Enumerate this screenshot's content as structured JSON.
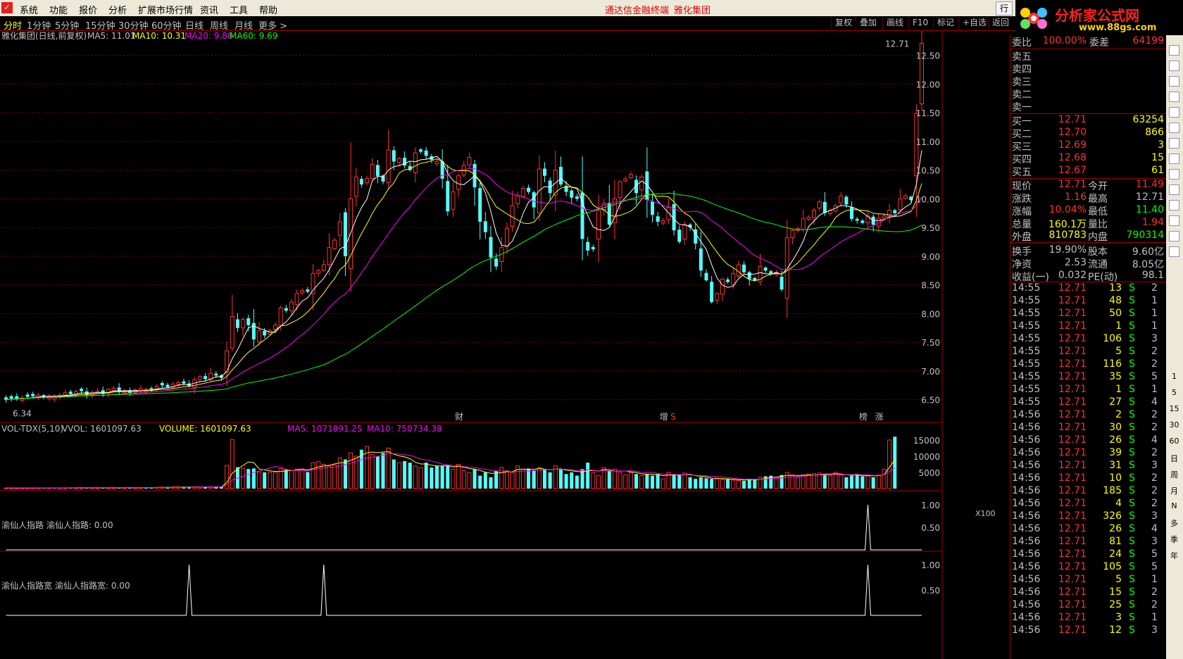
{
  "app": {
    "menu": [
      "系统",
      "功能",
      "报价",
      "分析",
      "扩展市场行情",
      "资讯",
      "工具",
      "帮助"
    ],
    "center_title_1": "通达信金融终端",
    "center_title_2": "雅化集团",
    "window_btn": "行"
  },
  "logo": {
    "title": "分析家公式网",
    "url": "www.88gs.com"
  },
  "periods": [
    "分时",
    "1分钟",
    "5分钟",
    "15分钟",
    "30分钟",
    "60分钟",
    "日线",
    "周线",
    "月线",
    "更多 >"
  ],
  "toolbar_buttons": [
    "复权",
    "叠加",
    "画线",
    "F10",
    "标记",
    "+自选",
    "返回"
  ],
  "main_chart": {
    "header": {
      "name": "雅化集团(日线,前复权)",
      "ma5": "MA5: 11.01",
      "ma10": "MA10: 10.31",
      "ma20": "MA20: 9.86",
      "ma60": "MA60: 9.69"
    },
    "high_label": "12.71",
    "low_label": "6.34",
    "markers": [
      {
        "i": 84,
        "text": "财"
      },
      {
        "i": 122,
        "text": "增"
      },
      {
        "i": 124,
        "text": "S"
      },
      {
        "i": 159,
        "text": "榜"
      },
      {
        "i": 162,
        "text": "涨"
      }
    ],
    "y_ticks": [
      "12.50",
      "12.00",
      "11.50",
      "11.00",
      "10.50",
      "10.00",
      "9.50",
      "9.00",
      "8.50",
      "8.00",
      "7.50",
      "7.00",
      "6.50"
    ]
  },
  "chart_data": [
    {
      "type": "candlestick",
      "y_range": [
        6.3,
        12.85
      ],
      "ma_colors": {
        "ma5": "#ffffff",
        "ma10": "#ffff00",
        "ma20": "#ff00ff",
        "ma60": "#00ff00"
      },
      "up_color": "#ff3232",
      "down_color": "#54ffff",
      "close": [
        6.5,
        6.52,
        6.52,
        6.53,
        6.55,
        6.56,
        6.58,
        6.55,
        6.56,
        6.55,
        6.58,
        6.62,
        6.6,
        6.64,
        6.65,
        6.58,
        6.62,
        6.65,
        6.6,
        6.68,
        6.7,
        6.64,
        6.66,
        6.62,
        6.67,
        6.69,
        6.68,
        6.66,
        6.73,
        6.75,
        6.72,
        6.77,
        6.8,
        6.78,
        6.74,
        6.85,
        6.9,
        6.86,
        6.96,
        6.92,
        6.88,
        7.35,
        7.95,
        7.75,
        7.9,
        7.8,
        7.55,
        7.7,
        7.62,
        7.7,
        7.8,
        8.1,
        8.05,
        8.2,
        8.35,
        8.4,
        8.38,
        8.7,
        8.75,
        8.85,
        9.15,
        9.28,
        9.6,
        9.0,
        10.0,
        10.38,
        10.25,
        10.35,
        10.6,
        10.4,
        10.3,
        10.85,
        10.65,
        10.7,
        10.58,
        10.5,
        10.8,
        10.82,
        10.75,
        10.68,
        10.65,
        10.35,
        9.78,
        10.12,
        10.4,
        10.58,
        10.72,
        10.2,
        9.6,
        9.42,
        8.98,
        8.82,
        9.15,
        9.48,
        9.88,
        10.05,
        10.18,
        10.12,
        9.85,
        10.52,
        10.4,
        10.1,
        10.5,
        10.25,
        10.12,
        10.02,
        10.0,
        9.3,
        9.1,
        9.12,
        9.8,
        9.92,
        9.55,
        10.0,
        10.3,
        10.35,
        10.42,
        10.1,
        10.38,
        9.98,
        9.72,
        9.6,
        9.62,
        9.85,
        9.45,
        9.25,
        9.55,
        9.5,
        9.22,
        8.75,
        8.58,
        8.2,
        8.35,
        8.6,
        8.55,
        8.7,
        8.85,
        8.72,
        8.6,
        8.58,
        8.82,
        8.75,
        8.7,
        8.72,
        8.42,
        9.32,
        9.45,
        9.48,
        9.65,
        9.68,
        9.8,
        9.95,
        9.75,
        9.8,
        9.88,
        10.05,
        9.9,
        9.65,
        9.62,
        9.58,
        9.7,
        9.55,
        9.66,
        9.7,
        9.8,
        9.75,
        10.0,
        10.05,
        9.98,
        11.48,
        12.71
      ],
      "series": [
        {
          "name": "VOLUME",
          "values": [
            196,
            181,
            160,
            191,
            189,
            229,
            215,
            206,
            203,
            210,
            234,
            256,
            251,
            283,
            281,
            224,
            276,
            249,
            298,
            297,
            324,
            270,
            280,
            325,
            306,
            335,
            363,
            322,
            403,
            419,
            473,
            512,
            497,
            483,
            454,
            522,
            477,
            526,
            568,
            542,
            556,
            7180,
            15078,
            6610,
            6260,
            6042,
            6224,
            5124,
            5025,
            5018,
            5098,
            6178,
            6011,
            5624,
            6010,
            6025,
            5098,
            8000,
            8320,
            7500,
            7000,
            7300,
            9498,
            9000,
            11000,
            10000,
            12000,
            13000,
            10500,
            10000,
            11000,
            12500,
            9000,
            8000,
            8500,
            8000,
            7000,
            6500,
            8000,
            6500,
            7000,
            7000,
            7000,
            6000,
            7500,
            5500,
            5000,
            6000,
            4000,
            5000,
            3500,
            5500,
            6500,
            5500,
            5000,
            7000,
            6000,
            6200,
            5500,
            6500,
            6000,
            5000,
            7000,
            6000,
            4500,
            5000,
            4000,
            6000,
            8000,
            5000,
            4000,
            6500,
            5500,
            6000,
            5000,
            4200,
            5000,
            4500,
            4000,
            4500,
            4000,
            4500,
            3000,
            5000,
            4500,
            4200,
            4800,
            3500,
            3000,
            3500,
            3200,
            3000,
            3000,
            2800,
            3000,
            2600,
            2500,
            2400,
            3000,
            3000,
            3500,
            3800,
            4000,
            3500,
            4200,
            5000,
            4000,
            3500,
            4000,
            4500,
            4600,
            4800,
            4500,
            4000,
            5000,
            4200,
            3500,
            4000,
            4500,
            3800,
            4000,
            3500,
            4200,
            6000,
            15000,
            16010
          ]
        }
      ],
      "tick_labels_volume": [
        "15000",
        "10000",
        "5000"
      ],
      "volume_unit_label": "X100"
    },
    {
      "type": "line",
      "name": "渝仙人指路",
      "x_peaks": [
        160
      ],
      "y_ticks": [
        "1.00",
        "0.50"
      ]
    },
    {
      "type": "line",
      "name": "渝仙人指路宽",
      "x_peaks": [
        34,
        59,
        160
      ],
      "y_ticks": [
        "1.00",
        "0.50"
      ]
    }
  ],
  "vol_panel": {
    "name": "VOL-TDX(5,10)",
    "vvol": "VVOL: 1601097.63",
    "volume": "VOLUME: 1601097.63",
    "ma5": "MA5: 1071891.25",
    "ma10": "MA10: 750734.38"
  },
  "ind1": {
    "name": "渝仙人指路",
    "value": "渝仙人指路: 0.00"
  },
  "ind2": {
    "name": "渝仙人指路宽",
    "value": "渝仙人指路宽: 0.00"
  },
  "quote": {
    "webi_label": "委比",
    "webi": "100.00%",
    "weicha_label": "委差",
    "weicha": "64199",
    "sell": [
      {
        "label": "卖五",
        "price": "",
        "vol": ""
      },
      {
        "label": "卖四",
        "price": "",
        "vol": ""
      },
      {
        "label": "卖三",
        "price": "",
        "vol": ""
      },
      {
        "label": "卖二",
        "price": "",
        "vol": ""
      },
      {
        "label": "卖一",
        "price": "",
        "vol": ""
      }
    ],
    "buy": [
      {
        "label": "买一",
        "price": "12.71",
        "vol": "63254"
      },
      {
        "label": "买二",
        "price": "12.70",
        "vol": "866"
      },
      {
        "label": "买三",
        "price": "12.69",
        "vol": "3"
      },
      {
        "label": "买四",
        "price": "12.68",
        "vol": "15"
      },
      {
        "label": "买五",
        "price": "12.67",
        "vol": "61"
      }
    ],
    "stats": [
      {
        "l1": "现价",
        "v1": "12.71",
        "l2": "今开",
        "v2": "11.49"
      },
      {
        "l1": "涨跌",
        "v1": "1.16",
        "l2": "最高",
        "v2": "12.71"
      },
      {
        "l1": "涨幅",
        "v1": "10.04%",
        "l2": "最低",
        "v2": "11.40"
      },
      {
        "l1": "总量",
        "v1": "160.1万",
        "l2": "量比",
        "v2": "1.94"
      },
      {
        "l1": "外盘",
        "v1": "810783",
        "l2": "内盘",
        "v2": "790314"
      },
      {
        "l1": "换手",
        "v1": "19.90%",
        "l2": "股本",
        "v2": "9.60亿"
      },
      {
        "l1": "净资",
        "v1": "2.53",
        "l2": "流通",
        "v2": "8.05亿"
      },
      {
        "l1": "收益(一)",
        "v1": "0.032",
        "l2": "PE(动)",
        "v2": "98.1"
      }
    ],
    "ticks": [
      {
        "t": "14:55",
        "p": "12.71",
        "v": "13",
        "s": "S",
        "n": "2"
      },
      {
        "t": "14:55",
        "p": "12.71",
        "v": "48",
        "s": "S",
        "n": "1"
      },
      {
        "t": "14:55",
        "p": "12.71",
        "v": "50",
        "s": "S",
        "n": "1"
      },
      {
        "t": "14:55",
        "p": "12.71",
        "v": "1",
        "s": "S",
        "n": "1"
      },
      {
        "t": "14:55",
        "p": "12.71",
        "v": "106",
        "s": "S",
        "n": "3"
      },
      {
        "t": "14:55",
        "p": "12.71",
        "v": "5",
        "s": "S",
        "n": "2"
      },
      {
        "t": "14:55",
        "p": "12.71",
        "v": "116",
        "s": "S",
        "n": "2"
      },
      {
        "t": "14:55",
        "p": "12.71",
        "v": "35",
        "s": "S",
        "n": "5"
      },
      {
        "t": "14:55",
        "p": "12.71",
        "v": "1",
        "s": "S",
        "n": "1"
      },
      {
        "t": "14:55",
        "p": "12.71",
        "v": "27",
        "s": "S",
        "n": "4"
      },
      {
        "t": "14:56",
        "p": "12.71",
        "v": "2",
        "s": "S",
        "n": "2"
      },
      {
        "t": "14:56",
        "p": "12.71",
        "v": "30",
        "s": "S",
        "n": "2"
      },
      {
        "t": "14:56",
        "p": "12.71",
        "v": "26",
        "s": "S",
        "n": "4"
      },
      {
        "t": "14:56",
        "p": "12.71",
        "v": "39",
        "s": "S",
        "n": "2"
      },
      {
        "t": "14:56",
        "p": "12.71",
        "v": "31",
        "s": "S",
        "n": "3"
      },
      {
        "t": "14:56",
        "p": "12.71",
        "v": "10",
        "s": "S",
        "n": "2"
      },
      {
        "t": "14:56",
        "p": "12.71",
        "v": "185",
        "s": "S",
        "n": "2"
      },
      {
        "t": "14:56",
        "p": "12.71",
        "v": "4",
        "s": "S",
        "n": "2"
      },
      {
        "t": "14:56",
        "p": "12.71",
        "v": "326",
        "s": "S",
        "n": "3"
      },
      {
        "t": "14:56",
        "p": "12.71",
        "v": "26",
        "s": "S",
        "n": "4"
      },
      {
        "t": "14:56",
        "p": "12.71",
        "v": "81",
        "s": "S",
        "n": "3"
      },
      {
        "t": "14:56",
        "p": "12.71",
        "v": "24",
        "s": "S",
        "n": "5"
      },
      {
        "t": "14:56",
        "p": "12.71",
        "v": "105",
        "s": "S",
        "n": "5"
      },
      {
        "t": "14:56",
        "p": "12.71",
        "v": "5",
        "s": "S",
        "n": "1"
      },
      {
        "t": "14:56",
        "p": "12.71",
        "v": "15",
        "s": "S",
        "n": "2"
      },
      {
        "t": "14:56",
        "p": "12.71",
        "v": "25",
        "s": "S",
        "n": "2"
      },
      {
        "t": "14:56",
        "p": "12.71",
        "v": "3",
        "s": "S",
        "n": "1"
      },
      {
        "t": "14:56",
        "p": "12.71",
        "v": "12",
        "s": "S",
        "n": "3"
      }
    ]
  },
  "side_tabs": [
    "1",
    "5",
    "15",
    "30",
    "60",
    "日",
    "周",
    "月",
    "N",
    "多",
    "季",
    "年"
  ]
}
